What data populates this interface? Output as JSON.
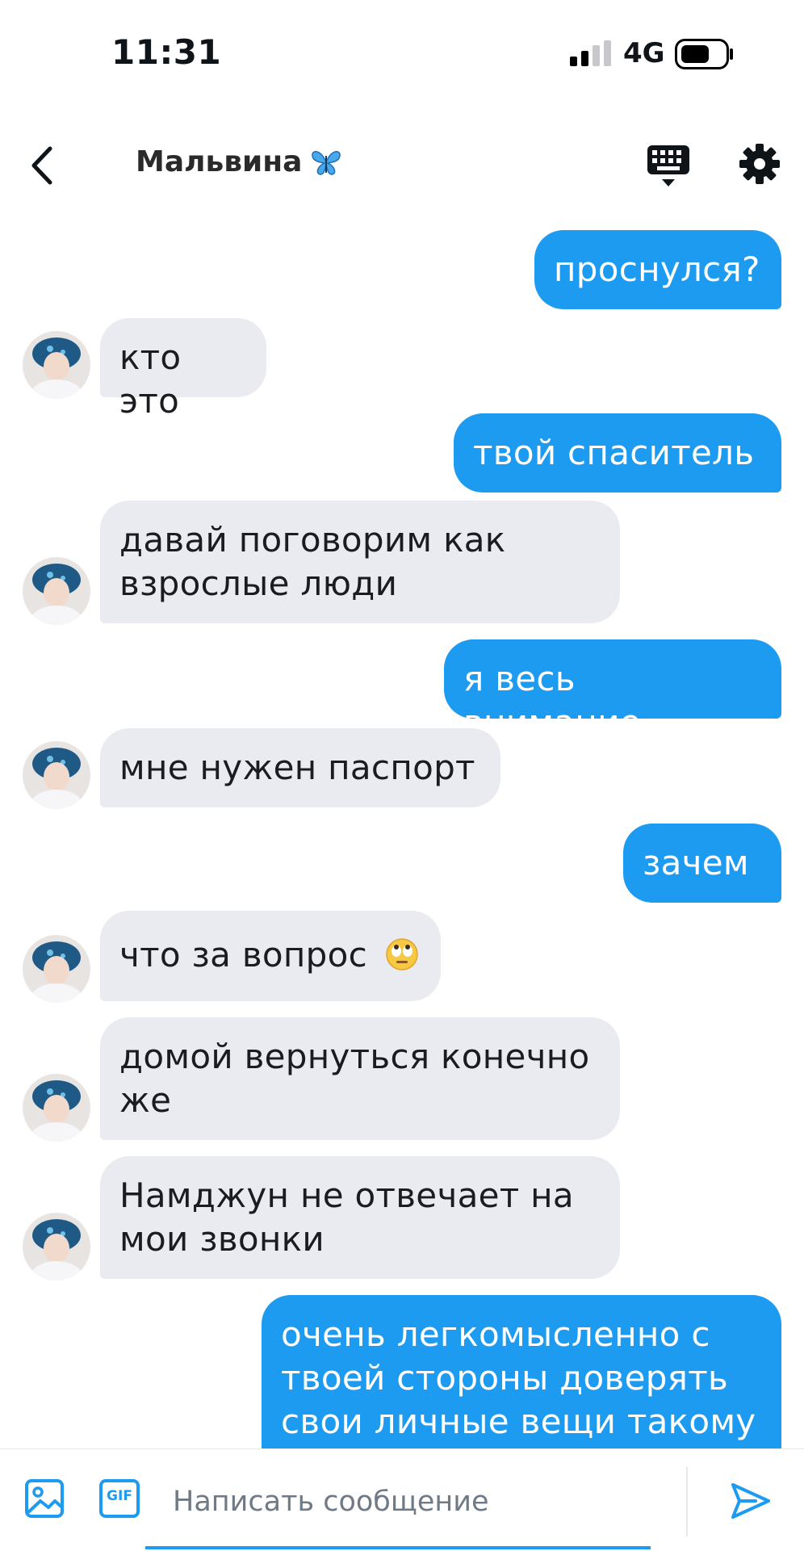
{
  "status_bar": {
    "time": "11:31",
    "network": "4G"
  },
  "header": {
    "title": "Мальвина",
    "title_emoji": "butterfly",
    "back_icon": "chevron-left-icon",
    "keyboard_icon": "keyboard-icon",
    "settings_icon": "gear-icon"
  },
  "messages": [
    {
      "direction": "out",
      "text": "проснулся?"
    },
    {
      "direction": "in",
      "text": "кто это"
    },
    {
      "direction": "out",
      "text": "твой спаситель"
    },
    {
      "direction": "in",
      "text": "давай поговорим как\nвзрослые люди"
    },
    {
      "direction": "out",
      "text": "я весь внимание"
    },
    {
      "direction": "in",
      "text": "мне нужен паспорт"
    },
    {
      "direction": "out",
      "text": "зачем"
    },
    {
      "direction": "in",
      "text": "что за вопрос",
      "emoji": "face-with-rolling-eyes"
    },
    {
      "direction": "in",
      "text": "домой вернуться конечно\nже"
    },
    {
      "direction": "in",
      "text": "Намджун не отвечает на\nмои звонки"
    },
    {
      "direction": "out",
      "text": "очень легкомысленно с\nтвоей стороны доверять\nсвои личные вещи такому"
    }
  ],
  "composer": {
    "placeholder": "Написать сообщение",
    "gif_label": "GIF"
  },
  "colors": {
    "accent": "#1d9bf0",
    "incoming_bubble": "#eaebf1",
    "outgoing_text": "#ffffff"
  }
}
